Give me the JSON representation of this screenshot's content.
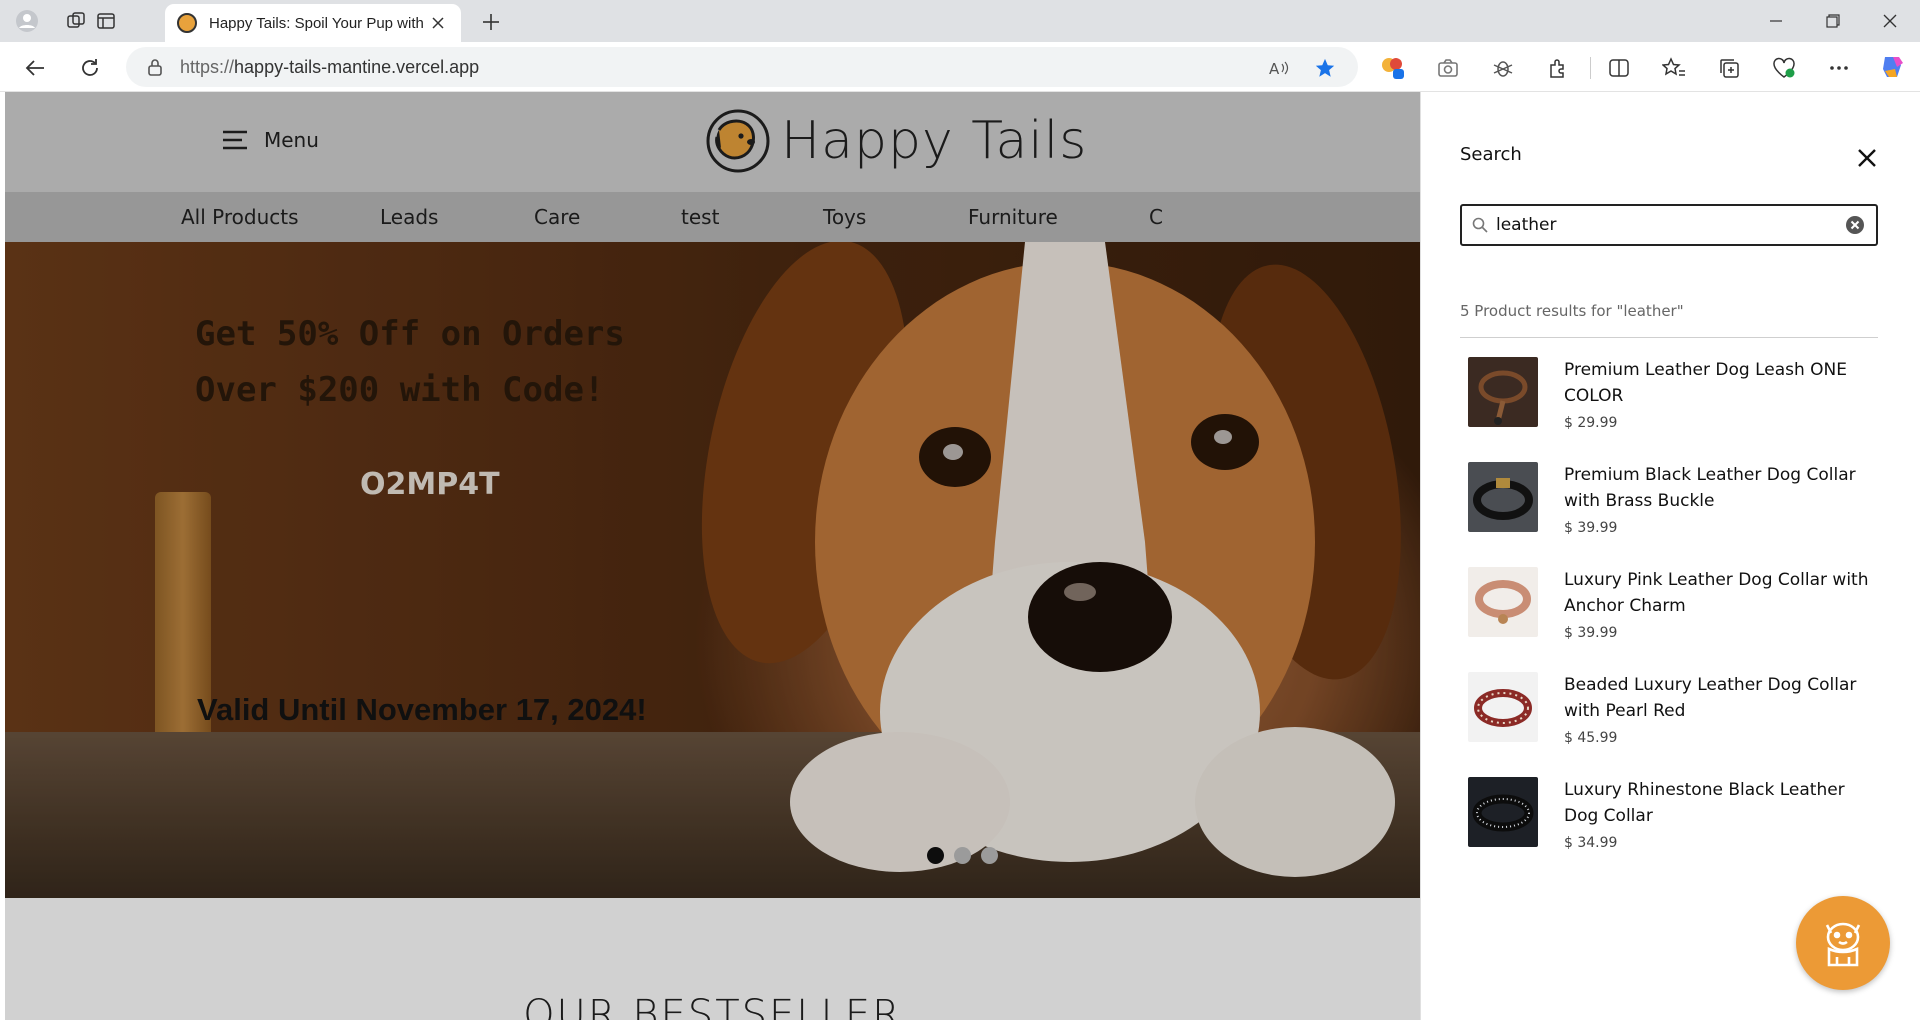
{
  "browser": {
    "tab_title": "Happy Tails: Spoil Your Pup with L",
    "url_scheme": "https://",
    "url_host": "happy-tails-mantine.vercel.app"
  },
  "site": {
    "menu_label": "Menu",
    "brand_name": "Happy Tails",
    "categories": [
      "All Products",
      "Leads",
      "Care",
      "test",
      "Toys",
      "Furniture",
      "C"
    ]
  },
  "hero": {
    "line1": "Get 50% Off on Orders",
    "line2": "Over $200 with Code!",
    "code": "O2MP4T",
    "valid_until": "Valid Until November 17, 2024!",
    "slide_count": 3,
    "active_slide": 1
  },
  "bestseller_heading": "OUR BESTSELLER",
  "search": {
    "title": "Search",
    "query": "leather",
    "results_label": "5 Product results for \"leather\"",
    "results": [
      {
        "name": "Premium Leather Dog Leash ONE COLOR",
        "price": "$ 29.99",
        "thumb": "leash"
      },
      {
        "name": "Premium Black Leather Dog Collar with Brass Buckle",
        "price": "$ 39.99",
        "thumb": "black-collar"
      },
      {
        "name": "Luxury Pink Leather Dog Collar with Anchor Charm",
        "price": "$ 39.99",
        "thumb": "pink-collar"
      },
      {
        "name": "Beaded Luxury Leather Dog Collar with Pearl Red",
        "price": "$ 45.99",
        "thumb": "red-collar"
      },
      {
        "name": "Luxury Rhinestone Black Leather Dog Collar",
        "price": "$ 34.99",
        "thumb": "rhinestone-collar"
      }
    ]
  },
  "colors": {
    "accent_orange": "#ec9a36",
    "header_gray": "#d1d1d1",
    "nav_gray": "#b9b9b9"
  }
}
